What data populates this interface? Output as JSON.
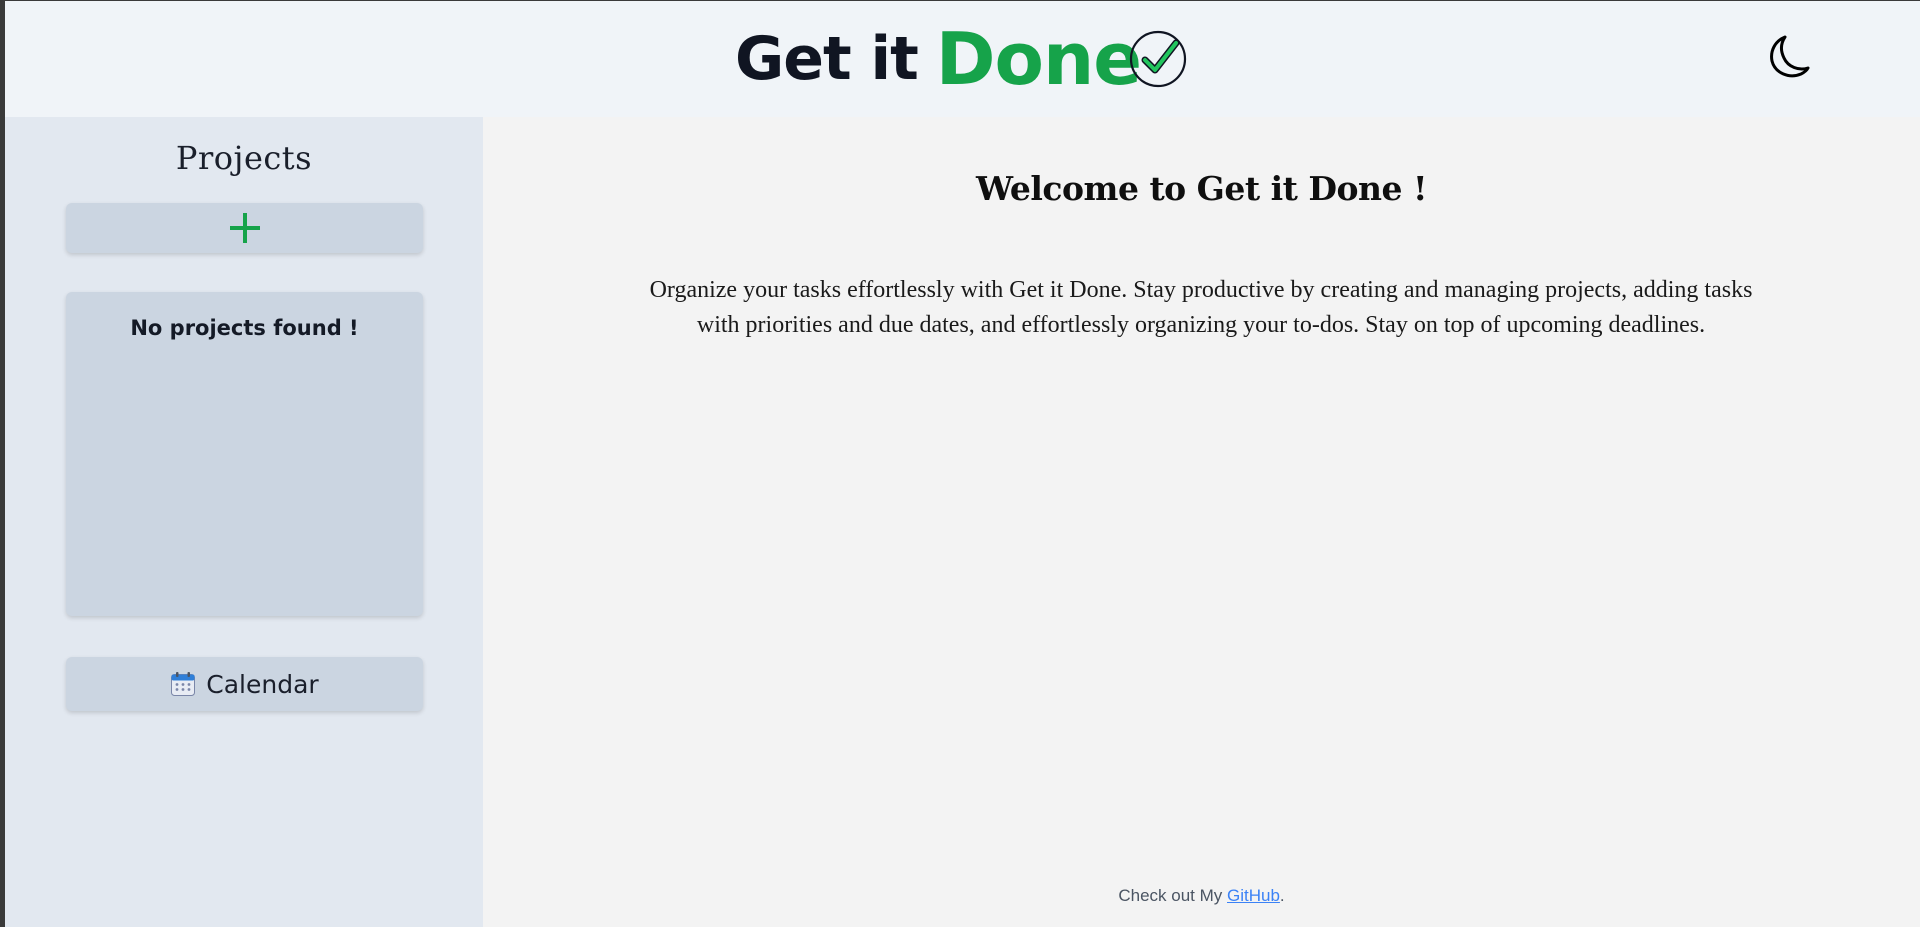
{
  "header": {
    "brand_part1": "Get it",
    "brand_part2": "Done",
    "brand_icon": "check-circle-icon",
    "theme_toggle_icon": "moon-icon",
    "accent_color": "#16a34a"
  },
  "sidebar": {
    "title": "Projects",
    "add_button_icon": "plus-icon",
    "empty_message": "No projects found !",
    "calendar_button": {
      "icon": "calendar-icon",
      "label": "Calendar"
    }
  },
  "main": {
    "title": "Welcome to Get it Done !",
    "description": "Organize your tasks effortlessly with Get it Done. Stay productive by creating and managing projects, adding tasks with priorities and due dates, and effortlessly organizing your to-dos. Stay on top of upcoming deadlines."
  },
  "footer": {
    "prefix": "Check out My ",
    "link_text": "GitHub",
    "suffix": "."
  }
}
